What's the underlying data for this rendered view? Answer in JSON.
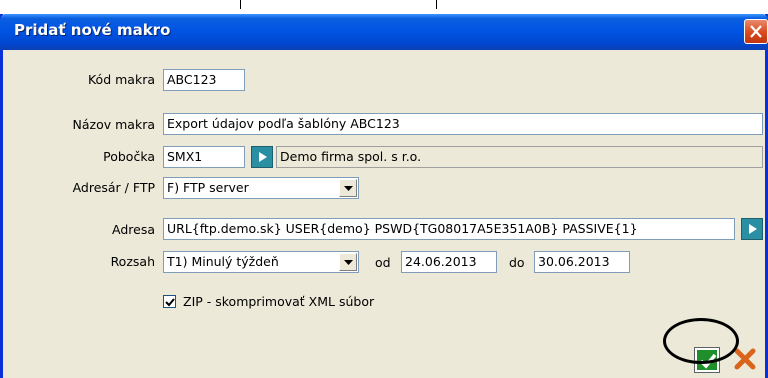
{
  "window": {
    "title": "Pridať nové makro"
  },
  "form": {
    "kod_label": "Kód makra",
    "kod_value": "ABC123",
    "nazov_label": "Názov makra",
    "nazov_value": "Export údajov podľa šablóny ABC123",
    "pobocka_label": "Pobočka",
    "pobocka_value": "SMX1",
    "pobocka_desc": "Demo firma spol. s r.o.",
    "adresar_label": "Adresár / FTP",
    "adresar_value": "F) FTP server",
    "adresa_label": "Adresa",
    "adresa_value": "URL{ftp.demo.sk} USER{demo} PSWD{TG08017A5E351A0B} PASSIVE{1}",
    "rozsah_label": "Rozsah",
    "rozsah_value": "T1) Minulý týždeň",
    "od_label": "od",
    "od_value": "24.06.2013",
    "do_label": "do",
    "do_value": "30.06.2013",
    "zip_label": "ZIP - skomprimovať XML súbor",
    "zip_checked": true
  },
  "colors": {
    "accent_teal": "#2b8fa3",
    "ok_green": "#1e8f2a",
    "title_blue": "#0054e3"
  },
  "icons": {
    "close": "close-x-icon",
    "picker": "play-triangle-icon",
    "ok": "checkmark-icon",
    "cancel": "cancel-x-icon"
  }
}
